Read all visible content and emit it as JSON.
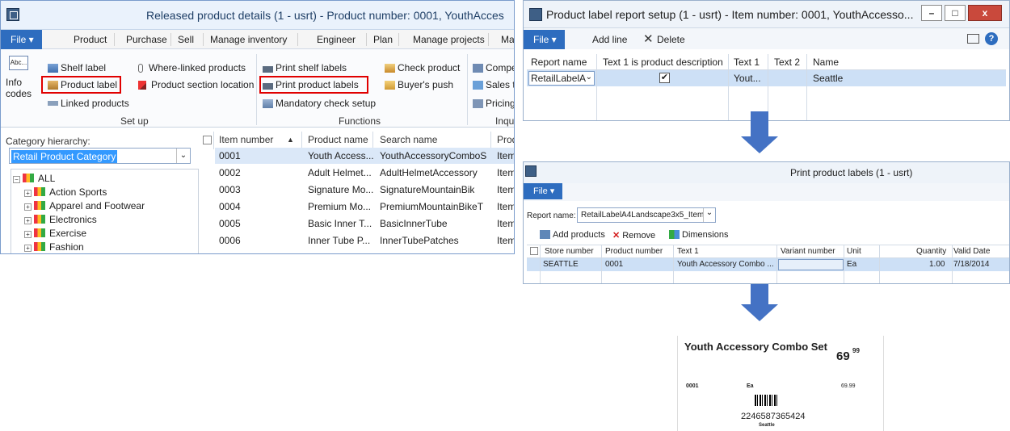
{
  "panel1": {
    "title": "Released product details (1 - usrt) - Product number: 0001, YouthAcces",
    "menu": {
      "file": "File",
      "tabs": [
        "Product",
        "Purchase",
        "Sell",
        "Manage inventory",
        "Engineer",
        "Plan",
        "Manage projects",
        "Ma"
      ]
    },
    "ribbon": {
      "info_codes": "Info codes",
      "abc": "Abc...",
      "shelf_label": "Shelf label",
      "product_label": "Product label",
      "linked_products": "Linked products",
      "where_linked": "Where-linked products",
      "product_section_location": "Product section location",
      "setup_group": "Set up",
      "print_shelf_labels": "Print shelf labels",
      "print_product_labels": "Print product labels",
      "mandatory_check_setup": "Mandatory check setup",
      "check_product": "Check product",
      "buyers_push": "Buyer's push",
      "functions_group": "Functions",
      "compe": "Compe",
      "sales_tr": "Sales tr",
      "pricing": "Pricing",
      "inqu_group": "Inqu"
    },
    "category": {
      "label": "Category hierarchy:",
      "selected": "Retail Product Category",
      "tree": [
        "ALL",
        "Action Sports",
        "Apparel and Footwear",
        "Electronics",
        "Exercise",
        "Fashion"
      ]
    },
    "grid": {
      "headers": [
        "Item number",
        "Product name",
        "Search name",
        "Prod"
      ],
      "rows": [
        [
          "0001",
          "Youth Access...",
          "YouthAccessoryComboS",
          "Item"
        ],
        [
          "0002",
          "Adult Helmet...",
          "AdultHelmetAccessory",
          "Item"
        ],
        [
          "0003",
          "Signature Mo...",
          "SignatureMountainBik",
          "Item"
        ],
        [
          "0004",
          "Premium Mo...",
          "PremiumMountainBikeT",
          "Item"
        ],
        [
          "0005",
          "Basic Inner T...",
          "BasicInnerTube",
          "Item"
        ],
        [
          "0006",
          "Inner Tube P...",
          "InnerTubePatches",
          "Item"
        ]
      ]
    }
  },
  "panel2": {
    "title": "Product label report setup (1 - usrt) - Item number: 0001, YouthAccesso...",
    "controls": {
      "min": "–",
      "max": "□",
      "close": "x"
    },
    "toolbar": {
      "file": "File",
      "add_line": "Add line",
      "delete": "Delete"
    },
    "headers": [
      "Report name",
      "Text 1 is product description",
      "Text 1",
      "Text 2",
      "Name"
    ],
    "row": {
      "report_name": "RetailLabelA",
      "text1_is_desc": "✔",
      "text1": "Yout...",
      "text2": "",
      "name": "Seattle"
    }
  },
  "panel3": {
    "title": "Print product labels (1 - usrt)",
    "toolbar": {
      "file": "File"
    },
    "report_label": "Report name:",
    "report_value": "RetailLabelA4Landscape3x5_Item",
    "actions": {
      "add_products": "Add products",
      "remove": "Remove",
      "dimensions": "Dimensions"
    },
    "headers": [
      "Store number",
      "Product number",
      "Text 1",
      "Variant number",
      "Unit",
      "Quantity",
      "Valid Date"
    ],
    "row": {
      "store": "SEATTLE",
      "product": "0001",
      "text1": "Youth Accessory Combo ...",
      "variant": "",
      "unit": "Ea",
      "quantity": "1.00",
      "valid_date": "7/18/2014"
    }
  },
  "label": {
    "title": "Youth Accessory Combo Set",
    "price_main": "69",
    "price_cents": "99",
    "item": "0001",
    "unit": "Ea",
    "price_small": "69.99",
    "barcode": "2246587365424",
    "store": "Seattle"
  },
  "colors": {
    "accent": "#2e6dbf",
    "arrow": "#4472c4",
    "highlight": "#e00000"
  }
}
